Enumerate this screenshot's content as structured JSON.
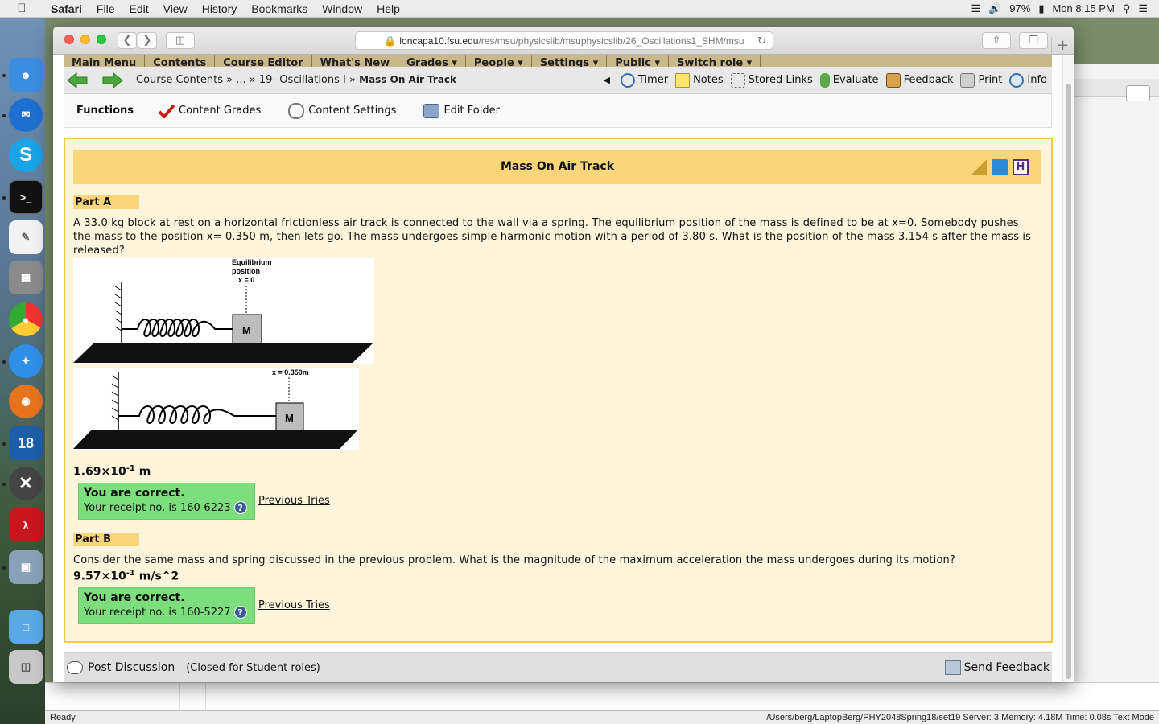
{
  "menubar": {
    "app": "Safari",
    "items": [
      "File",
      "Edit",
      "View",
      "History",
      "Bookmarks",
      "Window",
      "Help"
    ],
    "battery": "97%",
    "clock": "Mon 8:15 PM"
  },
  "browser": {
    "url_host": "loncapa10.fsu.edu",
    "url_path": "/res/msu/physicslib/msuphysicslib/26_Oscillations1_SHM/msu",
    "new_tab": "+"
  },
  "lon_menu": {
    "items": [
      "Main Menu",
      "Contents",
      "Course Editor",
      "What's New",
      "Grades ▾",
      "People ▾",
      "Settings ▾",
      "Public ▾",
      "Switch role ▾"
    ]
  },
  "breadcrumbs": {
    "course_contents": "Course Contents",
    "sep1": "»",
    "ellipsis": "...",
    "sep2": "»",
    "folder": "19- Oscillations I",
    "sep3": "»",
    "current": "Mass On Air Track"
  },
  "tools": {
    "timer": "Timer",
    "notes": "Notes",
    "stored_links": "Stored Links",
    "evaluate": "Evaluate",
    "feedback": "Feedback",
    "print": "Print",
    "info": "Info"
  },
  "functions": {
    "title": "Functions",
    "content_grades": "Content Grades",
    "content_settings": "Content Settings",
    "edit_folder": "Edit Folder"
  },
  "problem": {
    "title": "Mass On Air Track",
    "part_a": {
      "label": "Part A",
      "question": "A 33.0 kg block at rest on a horizontal frictionless air track is connected to the wall via a spring. The equilibrium position of the mass is defined to be at x=0. Somebody pushes the mass to the position x= 0.350 m, then lets go. The mass undergoes simple harmonic motion with a period of 3.80 s. What is the position of the mass 3.154 s after the mass is released?",
      "diagram_top_label1": "Equilibrium",
      "diagram_top_label2": "position",
      "diagram_top_label3": "x = 0",
      "diagram_mass": "M",
      "diagram_bottom_label": "x = 0.350m",
      "answer_base": "1.69×10",
      "answer_exp": "-1",
      "answer_unit": "m",
      "correct": "You are correct.",
      "receipt": "Your receipt no. is 160-6223",
      "previous": "Previous Tries"
    },
    "part_b": {
      "label": "Part B",
      "question": "Consider the same mass and spring discussed in the previous problem. What is the magnitude of the maximum acceleration the mass undergoes during its motion?",
      "answer_base": "9.57×10",
      "answer_exp": "-1",
      "answer_unit": "m/s^2",
      "correct": "You are correct.",
      "receipt": "Your receipt no. is 160-5227",
      "previous": "Previous Tries"
    }
  },
  "bottom": {
    "post_discussion": "Post Discussion",
    "closed": "(Closed for Student roles)",
    "send_feedback": "Send Feedback"
  },
  "statusbar": {
    "left": "Ready",
    "right": "/Users/berg/LaptopBerg/PHY2048Spring18/set19   Server: 3   Memory: 4.18M   Time: 0.08s   Text Mode"
  },
  "help_glyph": "?",
  "dock": {
    "calendar_day": "18"
  }
}
